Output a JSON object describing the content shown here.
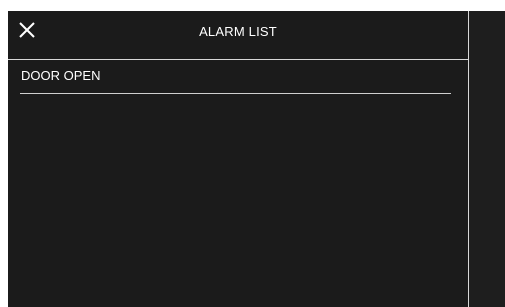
{
  "header": {
    "title": "ALARM LIST",
    "close_icon": "close-icon"
  },
  "alarms": [
    {
      "label": "DOOR OPEN"
    }
  ],
  "colors": {
    "background": "#1b1b1b",
    "text": "#ffffff",
    "divider": "#d8d8d8"
  }
}
